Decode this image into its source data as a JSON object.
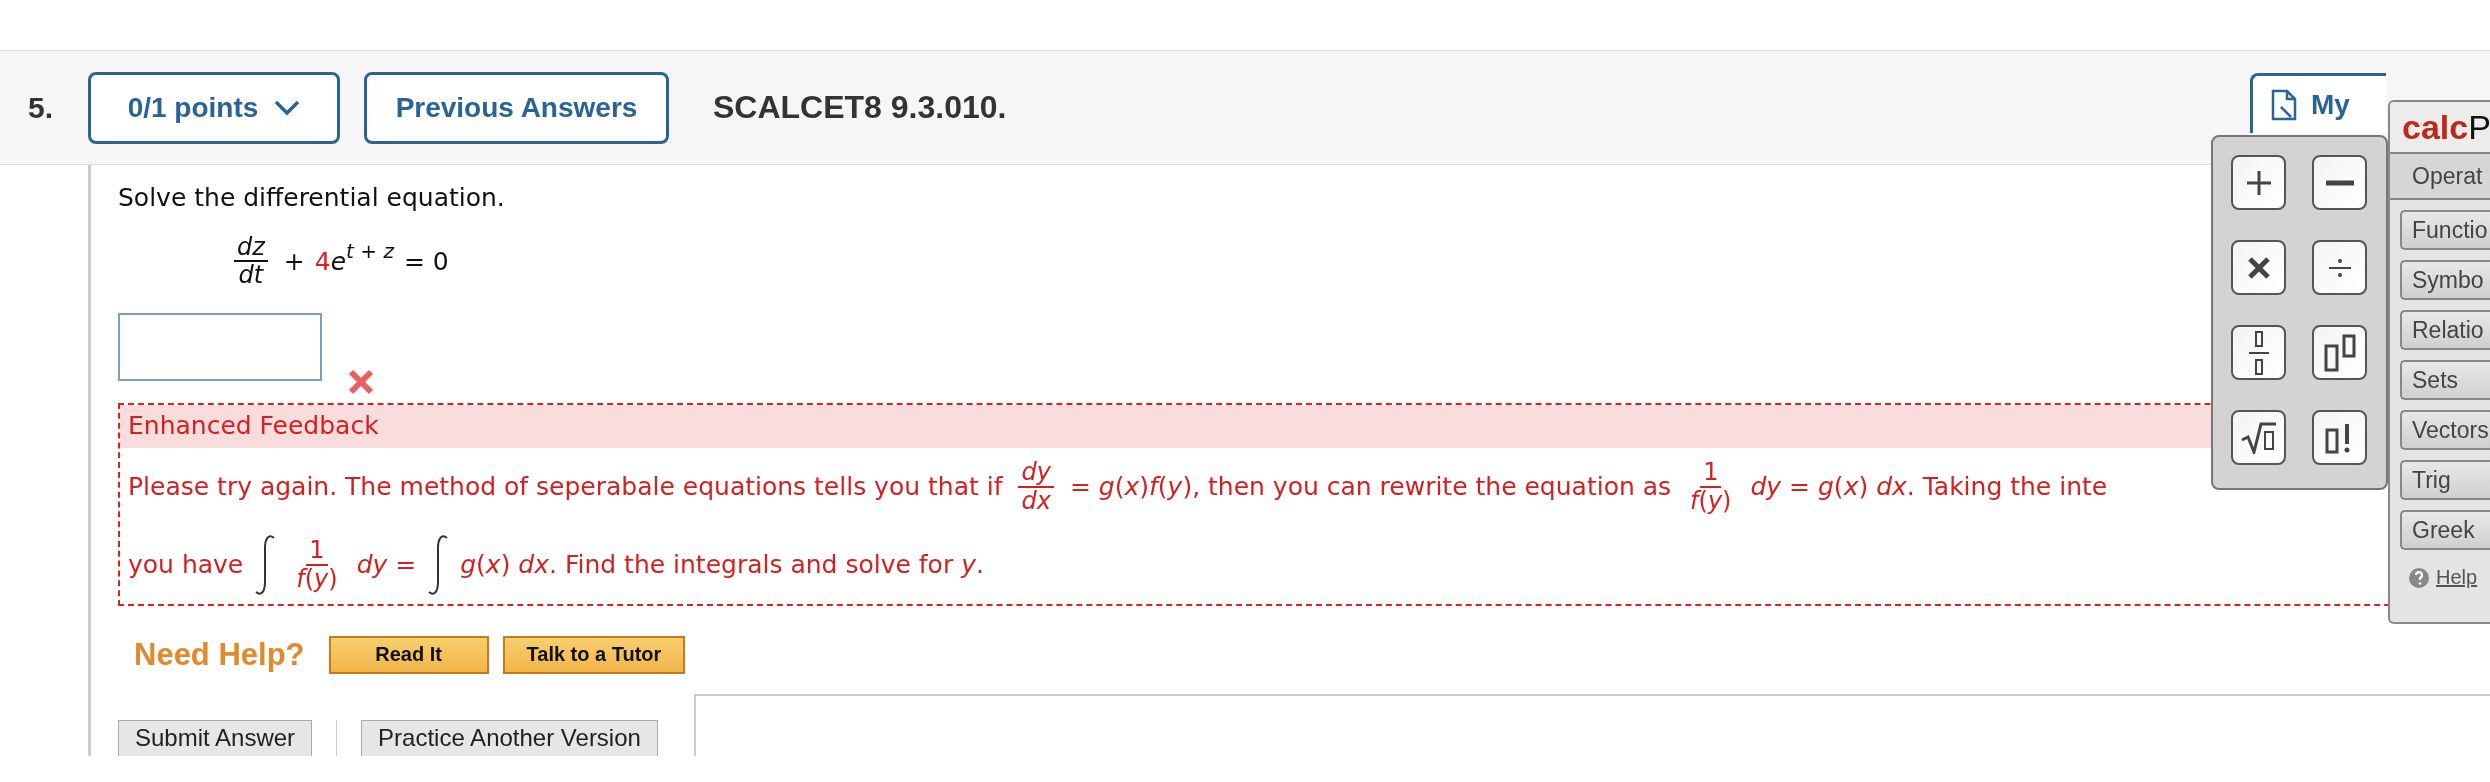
{
  "question": {
    "number": "5.",
    "points": "0/1 points",
    "previous": "Previous Answers",
    "code": "SCALCET8 9.3.010.",
    "notes": "My",
    "prompt": "Solve the differential equation.",
    "equation": {
      "numerator": "*dz*",
      "denominator": "*dt*",
      "plus": "+",
      "coefficient": "4",
      "base": "*e*",
      "exponent": "*t* + *z*",
      "rhs": "= 0"
    },
    "answer": {
      "correct": false
    }
  },
  "feedback": {
    "title": "Enhanced Feedback",
    "lines": [
      [
        {
          "kind": "text",
          "text": "Please try again. The method of seperabale equations tells you that if"
        },
        {
          "kind": "frac",
          "num": "*dy*",
          "den": "*dx*"
        },
        {
          "kind": "text",
          "text": "= *g*(*x*)*f*(*y*),  then you can rewrite the equation as"
        },
        {
          "kind": "frac",
          "num": "1",
          "den": "*f*(*y*)"
        },
        {
          "kind": "text",
          "text": "*dy* = *g*(*x*) *dx*.  Taking the inte"
        }
      ],
      [
        {
          "kind": "text",
          "text": "you have"
        },
        {
          "kind": "integral"
        },
        {
          "kind": "frac",
          "num": "1",
          "den": "*f*(*y*)"
        },
        {
          "kind": "text",
          "text": "*dy* ="
        },
        {
          "kind": "integral"
        },
        {
          "kind": "text",
          "text": "*g*(*x*) *dx*.  Find the integrals and solve for *y*."
        }
      ]
    ]
  },
  "help": {
    "label": "Need Help?",
    "buttons": [
      "Read It",
      "Talk to a Tutor"
    ]
  },
  "actions": {
    "submit": "Submit Answer",
    "practice": "Practice Another Version"
  },
  "palette": {
    "buttons": [
      {
        "kind": "plus"
      },
      {
        "kind": "minus"
      },
      {
        "kind": "times"
      },
      {
        "kind": "divide"
      },
      {
        "kind": "fraction"
      },
      {
        "kind": "power"
      },
      {
        "kind": "root"
      },
      {
        "kind": "factorial"
      }
    ]
  },
  "calcpad": {
    "brand": "calc",
    "brand_rest": "P",
    "tabs": [
      {
        "label": "Operat",
        "selected": true
      },
      {
        "label": "Functio",
        "selected": false
      },
      {
        "label": "Symbo",
        "selected": false
      },
      {
        "label": "Relatio",
        "selected": false
      },
      {
        "label": "Sets",
        "selected": false
      },
      {
        "label": "Vectors",
        "selected": false
      },
      {
        "label": "Trig",
        "selected": false
      },
      {
        "label": "Greek",
        "selected": false
      }
    ],
    "help": "Help"
  }
}
